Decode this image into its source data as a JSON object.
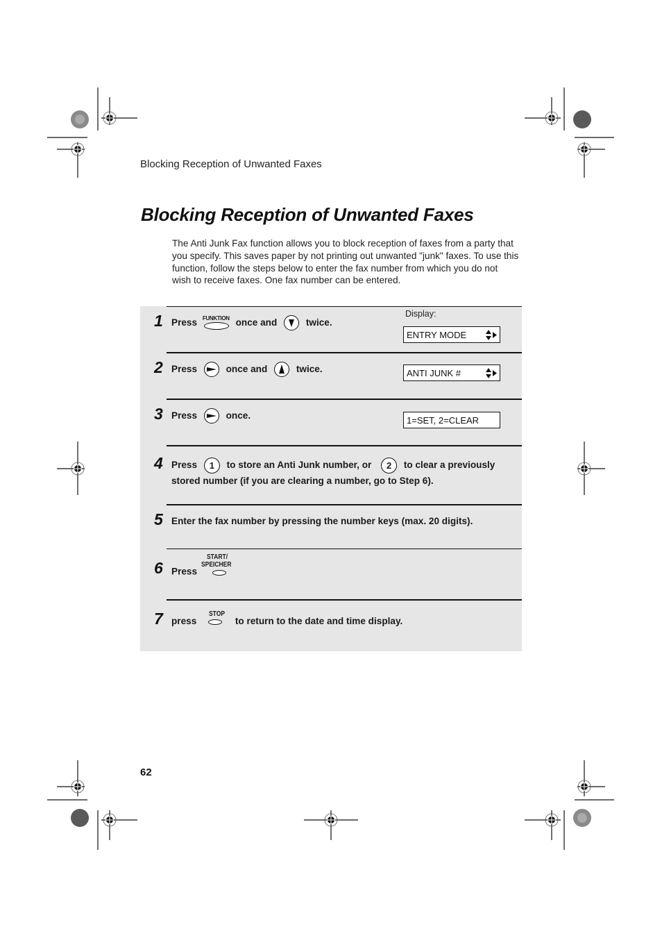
{
  "running_head": "Blocking Reception of Unwanted Faxes",
  "title": "Blocking Reception of Unwanted Faxes",
  "intro": "The Anti Junk Fax function allows you to block reception of faxes from a party that you specify. This saves paper by not printing out unwanted \"junk\" faxes. To use this function, follow the steps below to enter the fax number from which you do not wish to receive faxes. One fax number can be entered.",
  "display_label": "Display:",
  "steps": [
    {
      "num": "1",
      "press": "Press",
      "key": "FUNKTION",
      "mid": "once and",
      "end": "twice.",
      "display": "ENTRY MODE"
    },
    {
      "num": "2",
      "press": "Press",
      "mid": "once and",
      "end": "twice.",
      "display": "ANTI JUNK #"
    },
    {
      "num": "3",
      "press": "Press",
      "end": "once.",
      "display": "1=SET, 2=CLEAR"
    },
    {
      "num": "4",
      "press": "Press",
      "key1": "1",
      "mid": "to store an Anti Junk number, or",
      "key2": "2",
      "end": "to clear a previously",
      "line2": "stored number (if you are clearing a number, go to Step 6)."
    },
    {
      "num": "5",
      "text": "Enter the fax number by pressing the number keys (max. 20 digits)."
    },
    {
      "num": "6",
      "press": "Press",
      "key_top": "START/",
      "key_bottom": "SPEICHER"
    },
    {
      "num": "7",
      "press": "press",
      "key": "STOP",
      "end": "to return to the date and time display."
    }
  ],
  "page_number": "62"
}
